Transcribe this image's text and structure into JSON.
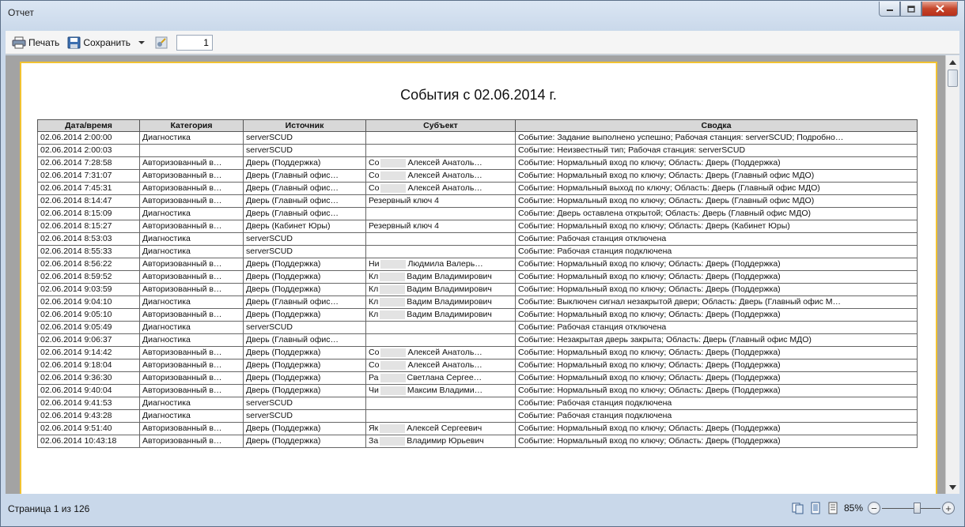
{
  "window": {
    "title": "Отчет"
  },
  "toolbar": {
    "print_label": "Печать",
    "save_label": "Сохранить",
    "page_value": "1"
  },
  "report": {
    "title": "События с 02.06.2014 г.",
    "columns": [
      "Дата/время",
      "Категория",
      "Источник",
      "Субъект",
      "Сводка"
    ],
    "rows": [
      {
        "date": "02.06.2014 2:00:00",
        "category": "Диагностика",
        "source": "serverSCUD",
        "subject_a": "",
        "subject_b": "",
        "summary": "Событие: Задание выполнено успешно; Рабочая станция: serverSCUD; Подробно…"
      },
      {
        "date": "02.06.2014 2:00:03",
        "category": "",
        "source": "serverSCUD",
        "subject_a": "",
        "subject_b": "",
        "summary": "Событие: Неизвестный тип; Рабочая станция: serverSCUD"
      },
      {
        "date": "02.06.2014 7:28:58",
        "category": "Авторизованный в…",
        "source": "Дверь (Поддержка)",
        "subject_a": "Со",
        "subject_b": "Алексей Анатоль…",
        "summary": "Событие: Нормальный вход по ключу; Область: Дверь (Поддержка)"
      },
      {
        "date": "02.06.2014 7:31:07",
        "category": "Авторизованный в…",
        "source": "Дверь (Главный офис…",
        "subject_a": "Со",
        "subject_b": "Алексей Анатоль…",
        "summary": "Событие: Нормальный вход по ключу; Область: Дверь (Главный офис МДО)"
      },
      {
        "date": "02.06.2014 7:45:31",
        "category": "Авторизованный в…",
        "source": "Дверь (Главный офис…",
        "subject_a": "Со",
        "subject_b": "Алексей Анатоль…",
        "summary": "Событие: Нормальный выход по ключу; Область: Дверь (Главный офис МДО)"
      },
      {
        "date": "02.06.2014 8:14:47",
        "category": "Авторизованный в…",
        "source": "Дверь (Главный офис…",
        "subject_a": "Резервный ключ 4",
        "subject_b": "",
        "summary": "Событие: Нормальный вход по ключу; Область: Дверь (Главный офис МДО)"
      },
      {
        "date": "02.06.2014 8:15:09",
        "category": "Диагностика",
        "source": "Дверь (Главный офис…",
        "subject_a": "",
        "subject_b": "",
        "summary": "Событие: Дверь оставлена открытой; Область: Дверь (Главный офис МДО)"
      },
      {
        "date": "02.06.2014 8:15:27",
        "category": "Авторизованный в…",
        "source": "Дверь (Кабинет Юры)",
        "subject_a": "Резервный ключ 4",
        "subject_b": "",
        "summary": "Событие: Нормальный вход по ключу; Область: Дверь (Кабинет Юры)"
      },
      {
        "date": "02.06.2014 8:53:03",
        "category": "Диагностика",
        "source": "serverSCUD",
        "subject_a": "",
        "subject_b": "",
        "summary": "Событие: Рабочая станция отключена"
      },
      {
        "date": "02.06.2014 8:55:33",
        "category": "Диагностика",
        "source": "serverSCUD",
        "subject_a": "",
        "subject_b": "",
        "summary": "Событие: Рабочая станция подключена"
      },
      {
        "date": "02.06.2014 8:56:22",
        "category": "Авторизованный в…",
        "source": "Дверь (Поддержка)",
        "subject_a": "Ни",
        "subject_b": "Людмила Валерь…",
        "summary": "Событие: Нормальный вход по ключу; Область: Дверь (Поддержка)"
      },
      {
        "date": "02.06.2014 8:59:52",
        "category": "Авторизованный в…",
        "source": "Дверь (Поддержка)",
        "subject_a": "Кл",
        "subject_b": "Вадим Владимирович",
        "summary": "Событие: Нормальный вход по ключу; Область: Дверь (Поддержка)"
      },
      {
        "date": "02.06.2014 9:03:59",
        "category": "Авторизованный в…",
        "source": "Дверь (Поддержка)",
        "subject_a": "Кл",
        "subject_b": "Вадим Владимирович",
        "summary": "Событие: Нормальный вход по ключу; Область: Дверь (Поддержка)"
      },
      {
        "date": "02.06.2014 9:04:10",
        "category": "Диагностика",
        "source": "Дверь (Главный офис…",
        "subject_a": "Кл",
        "subject_b": "Вадим Владимирович",
        "summary": "Событие: Выключен сигнал незакрытой двери; Область: Дверь (Главный офис М…"
      },
      {
        "date": "02.06.2014 9:05:10",
        "category": "Авторизованный в…",
        "source": "Дверь (Поддержка)",
        "subject_a": "Кл",
        "subject_b": "Вадим Владимирович",
        "summary": "Событие: Нормальный вход по ключу; Область: Дверь (Поддержка)"
      },
      {
        "date": "02.06.2014 9:05:49",
        "category": "Диагностика",
        "source": "serverSCUD",
        "subject_a": "",
        "subject_b": "",
        "summary": "Событие: Рабочая станция отключена"
      },
      {
        "date": "02.06.2014 9:06:37",
        "category": "Диагностика",
        "source": "Дверь (Главный офис…",
        "subject_a": "",
        "subject_b": "",
        "summary": "Событие: Незакрытая дверь закрыта; Область: Дверь (Главный офис МДО)"
      },
      {
        "date": "02.06.2014 9:14:42",
        "category": "Авторизованный в…",
        "source": "Дверь (Поддержка)",
        "subject_a": "Со",
        "subject_b": "Алексей Анатоль…",
        "summary": "Событие: Нормальный вход по ключу; Область: Дверь (Поддержка)"
      },
      {
        "date": "02.06.2014 9:18:04",
        "category": "Авторизованный в…",
        "source": "Дверь (Поддержка)",
        "subject_a": "Со",
        "subject_b": "Алексей Анатоль…",
        "summary": "Событие: Нормальный вход по ключу; Область: Дверь (Поддержка)"
      },
      {
        "date": "02.06.2014 9:36:30",
        "category": "Авторизованный в…",
        "source": "Дверь (Поддержка)",
        "subject_a": "Ра",
        "subject_b": "Светлана Сергее…",
        "summary": "Событие: Нормальный вход по ключу; Область: Дверь (Поддержка)"
      },
      {
        "date": "02.06.2014 9:40:04",
        "category": "Авторизованный в…",
        "source": "Дверь (Поддержка)",
        "subject_a": "Чи",
        "subject_b": "Максим Владими…",
        "summary": "Событие: Нормальный вход по ключу; Область: Дверь (Поддержка)"
      },
      {
        "date": "02.06.2014 9:41:53",
        "category": "Диагностика",
        "source": "serverSCUD",
        "subject_a": "",
        "subject_b": "",
        "summary": "Событие: Рабочая станция подключена"
      },
      {
        "date": "02.06.2014 9:43:28",
        "category": "Диагностика",
        "source": "serverSCUD",
        "subject_a": "",
        "subject_b": "",
        "summary": "Событие: Рабочая станция подключена"
      },
      {
        "date": "02.06.2014 9:51:40",
        "category": "Авторизованный в…",
        "source": "Дверь (Поддержка)",
        "subject_a": "Як",
        "subject_b": "Алексей Сергеевич",
        "summary": "Событие: Нормальный вход по ключу; Область: Дверь (Поддержка)"
      },
      {
        "date": "02.06.2014 10:43:18",
        "category": "Авторизованный в…",
        "source": "Дверь (Поддержка)",
        "subject_a": "За",
        "subject_b": "Владимир Юрьевич",
        "summary": "Событие: Нормальный вход по ключу; Область: Дверь (Поддержка)"
      }
    ]
  },
  "status": {
    "page_info": "Страница 1 из 126",
    "zoom": "85%"
  },
  "colors": {
    "page_border": "#f1c232",
    "header_bg": "#d8d8d8",
    "viewer_bg": "#a3a3a3"
  }
}
